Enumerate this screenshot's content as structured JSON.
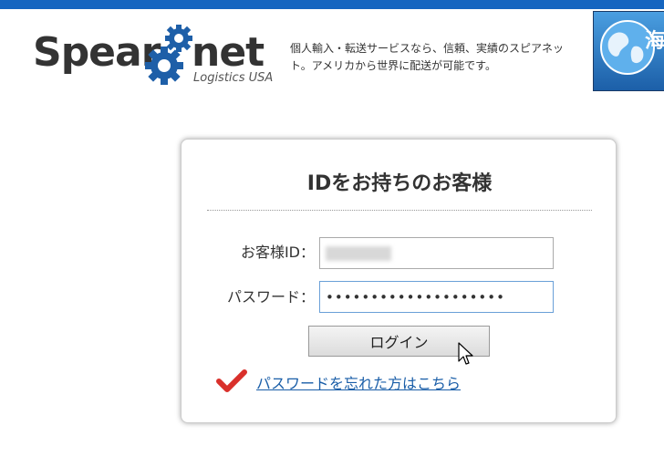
{
  "header": {
    "logo": {
      "word_left": "Spear",
      "word_right": "net",
      "subtitle": "Logistics USA"
    },
    "tagline": "個人輸入・転送サービスなら、信頼、実績のスピアネット。アメリカから世界に配送が可能です。",
    "banner_text": "海",
    "colors": {
      "top_bar": "#1565c0",
      "gear_blue": "#1e5fa8",
      "banner_blue": "#2f7fd0"
    }
  },
  "login": {
    "title": "IDをお持ちのお客様",
    "customer_id_label": "お客様ID：",
    "customer_id_value": "",
    "password_label": "パスワード：",
    "password_value": "••••••••••••••••••••",
    "login_button": "ログイン",
    "forgot_password_link": "パスワードを忘れた方はこちら",
    "colors": {
      "check_mark": "#d9302b",
      "link": "#1a5ea8",
      "focus_border": "#6aa0d8"
    }
  },
  "icons": {
    "gear": "gear-icon",
    "globe": "globe-icon",
    "check": "check-icon",
    "cursor": "cursor-icon"
  }
}
